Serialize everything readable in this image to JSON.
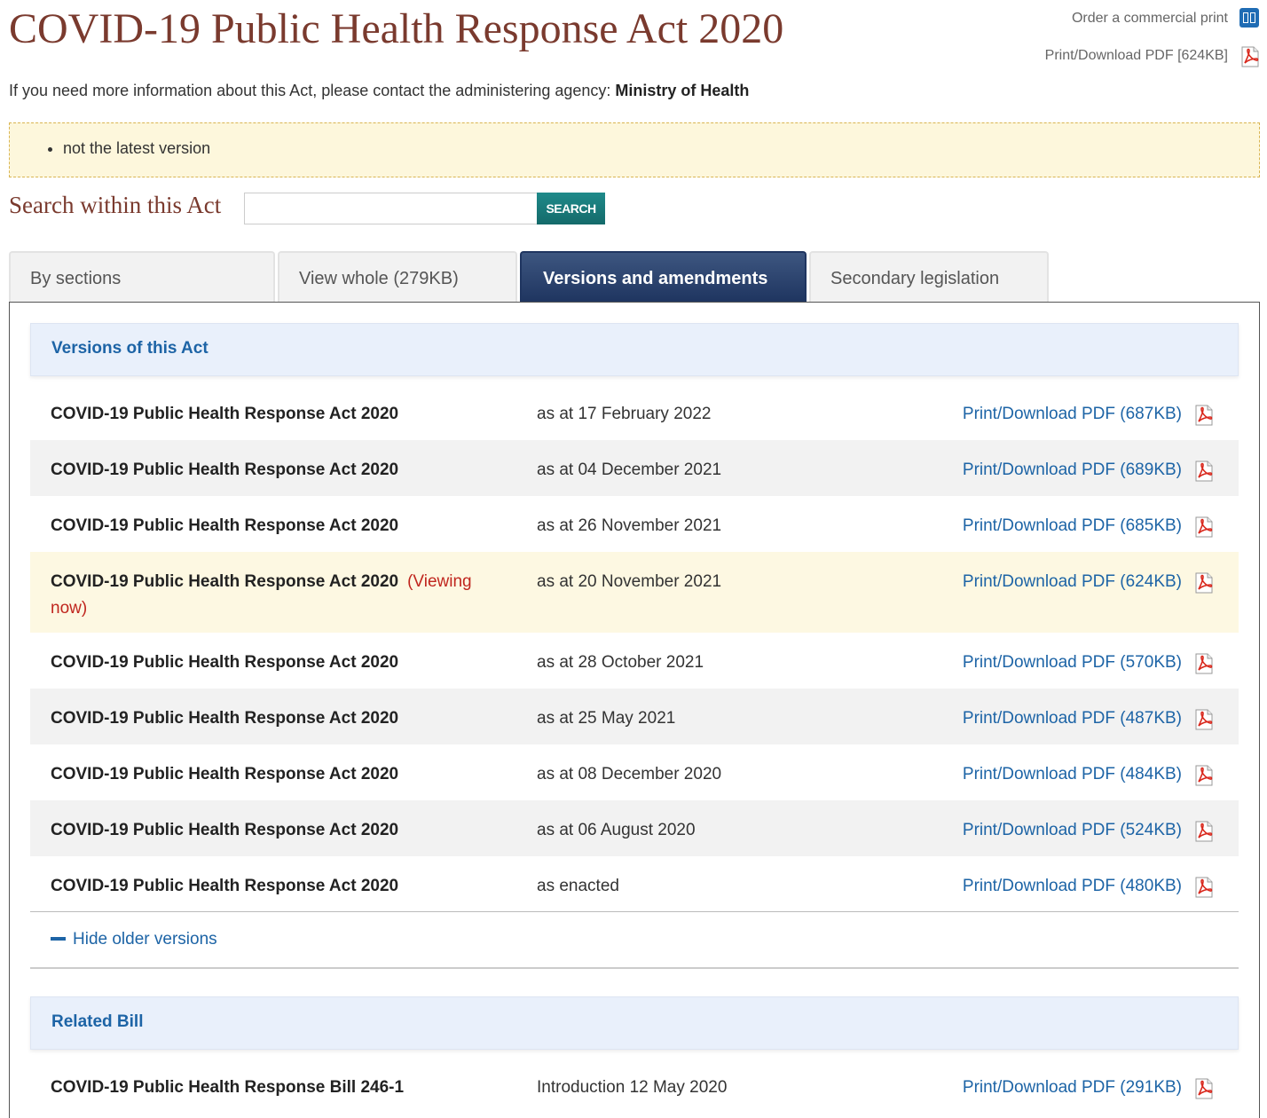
{
  "header": {
    "title": "COVID-19 Public Health Response Act 2020",
    "order_print": "Order a commercial print",
    "print_pdf": "Print/Download PDF [624KB]",
    "agency_prefix": "If you need more information about this Act, please contact the administering agency: ",
    "agency_name": "Ministry of Health"
  },
  "notice": {
    "items": [
      "not the latest version"
    ]
  },
  "search": {
    "label": "Search within this Act",
    "button": "SEARCH",
    "value": ""
  },
  "tabs": [
    {
      "label": "By sections",
      "active": false
    },
    {
      "label": "View whole (279KB)",
      "active": false
    },
    {
      "label": "Versions and amendments",
      "active": true
    },
    {
      "label": "Secondary legislation",
      "active": false
    }
  ],
  "versions": {
    "heading": "Versions of this Act",
    "rows": [
      {
        "name": "COVID-19 Public Health Response Act 2020",
        "date": "as at 17 February 2022",
        "link": "Print/Download PDF (687KB)"
      },
      {
        "name": "COVID-19 Public Health Response Act 2020",
        "date": "as at 04 December 2021",
        "link": "Print/Download PDF (689KB)"
      },
      {
        "name": "COVID-19 Public Health Response Act 2020",
        "date": "as at 26 November 2021",
        "link": "Print/Download PDF (685KB)"
      },
      {
        "name": "COVID-19 Public Health Response Act 2020",
        "viewing": "(Viewing now)",
        "date": "as at 20 November 2021",
        "link": "Print/Download PDF (624KB)"
      },
      {
        "name": "COVID-19 Public Health Response Act 2020",
        "date": "as at 28 October 2021",
        "link": "Print/Download PDF (570KB)"
      },
      {
        "name": "COVID-19 Public Health Response Act 2020",
        "date": "as at 25 May 2021",
        "link": "Print/Download PDF (487KB)"
      },
      {
        "name": "COVID-19 Public Health Response Act 2020",
        "date": "as at 08 December 2020",
        "link": "Print/Download PDF (484KB)"
      },
      {
        "name": "COVID-19 Public Health Response Act 2020",
        "date": "as at 06 August 2020",
        "link": "Print/Download PDF (524KB)"
      },
      {
        "name": "COVID-19 Public Health Response Act 2020",
        "date": "as enacted",
        "link": "Print/Download PDF (480KB)"
      }
    ],
    "hide_older": "Hide older versions"
  },
  "related_bill": {
    "heading": "Related Bill",
    "rows": [
      {
        "name": "COVID-19 Public Health Response Bill 246-1",
        "date": "Introduction 12 May 2020",
        "link": "Print/Download PDF (291KB)"
      }
    ]
  },
  "colors": {
    "title": "#7a3a2e",
    "link": "#1d64a6",
    "active_tab": "#1f3560",
    "search_button": "#1f8a8a",
    "notice_bg": "#fdf7dc",
    "viewing_now": "#c0261e"
  }
}
